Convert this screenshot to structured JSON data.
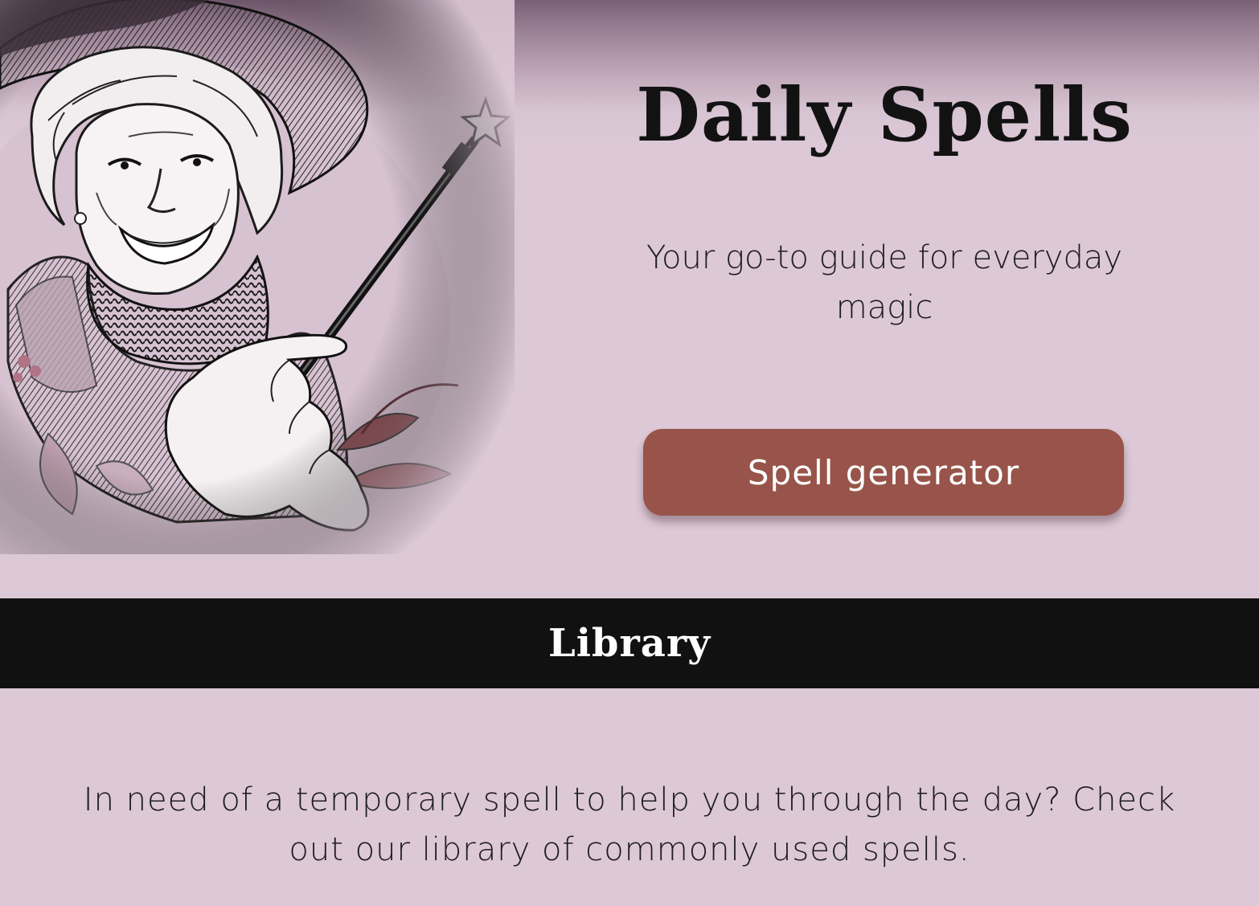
{
  "hero": {
    "title": "Daily Spells",
    "subtitle": "Your go-to guide for everyday magic",
    "cta_label": "Spell generator"
  },
  "library": {
    "heading": "Library",
    "description": "In need of a temporary spell to help you through the day? Check out our library of commonly used spells."
  },
  "illustration": {
    "icon": "witch-with-wand-illustration"
  },
  "colors": {
    "background": "#dcc8d6",
    "header_gradient_top": "#7a6076",
    "button": "#98544a",
    "library_bar": "#111111"
  }
}
